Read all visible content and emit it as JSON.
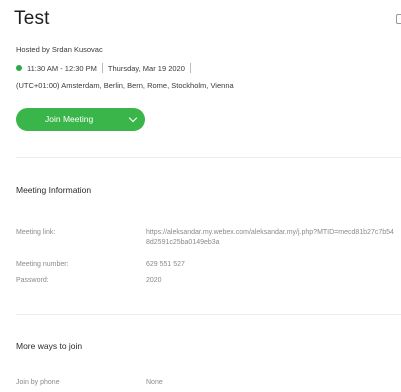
{
  "meeting": {
    "title": "Test",
    "host": "Hosted by Srdan Kusovac",
    "time": "11:30 AM - 12:30 PM",
    "date": "Thursday, Mar 19 2020",
    "timezone": "(UTC+01:00) Amsterdam, Berlin, Bern, Rome, Stockholm, Vienna",
    "status_color": "#2da84a"
  },
  "join_button": {
    "label": "Join Meeting",
    "color": "#3ab54a",
    "icon": "chevron-down-icon"
  },
  "meeting_info": {
    "heading": "Meeting Information",
    "link_label": "Meeting link:",
    "link_value": "https://aleksandar.my.webex.com/aleksandar.my/j.php?MTID=mecd81b27c7b548d2591c25ba0149eb3a",
    "number_label": "Meeting number:",
    "number_value": "629 551 527",
    "password_label": "Password:",
    "password_value": "2020"
  },
  "more_ways": {
    "heading": "More ways to join",
    "phone_label": "Join by phone",
    "phone_value": "None"
  }
}
